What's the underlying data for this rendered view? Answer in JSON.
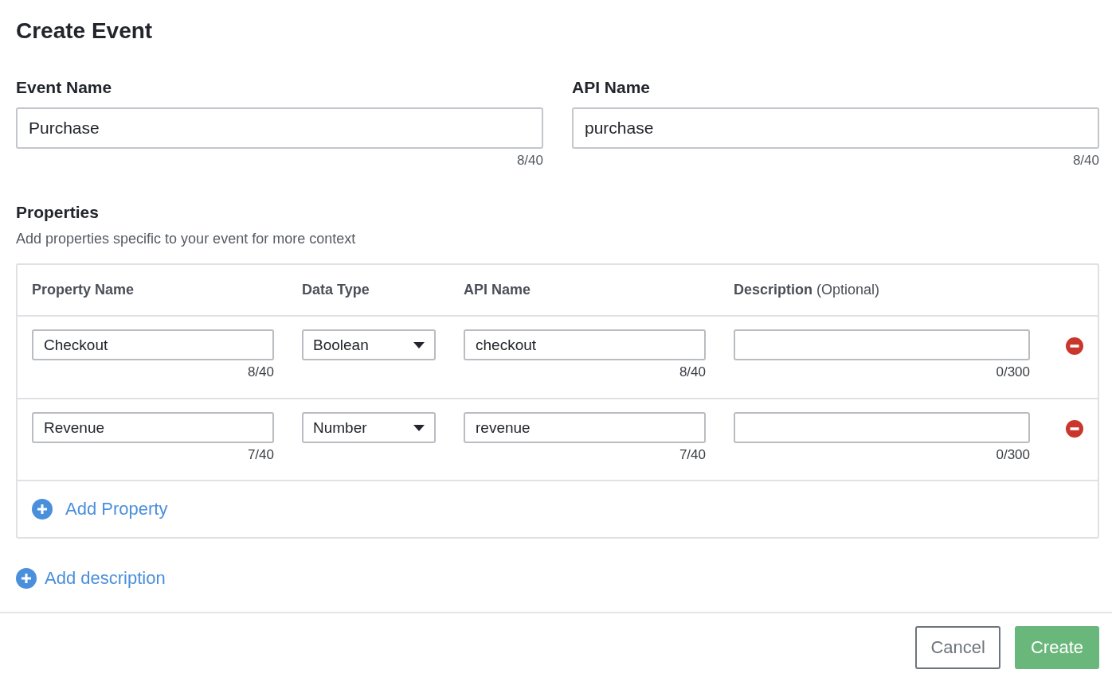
{
  "title": "Create Event",
  "fields": [
    {
      "label": "Event Name",
      "value": "Purchase",
      "counter": "8/40"
    },
    {
      "label": "API Name",
      "value": "purchase",
      "counter": "8/40"
    }
  ],
  "properties": {
    "heading": "Properties",
    "subtitle": "Add properties specific to your event for more context",
    "columns": [
      "Property Name",
      "Data Type",
      "API Name",
      "**Description** (Optional)"
    ],
    "rows": [
      {
        "name": "Checkout",
        "name_counter": "8/40",
        "data_type": "Boolean",
        "api_name": "checkout",
        "api_counter": "8/40",
        "description_counter": "0/300"
      },
      {
        "name": "Revenue",
        "name_counter": "7/40",
        "data_type": "Number",
        "api_name": "revenue",
        "api_counter": "7/40",
        "description_counter": "0/300"
      }
    ],
    "add_label": "Add Property"
  },
  "add_description": "Add description",
  "buttons": [
    {
      "label": "Cancel",
      "kind": "secondary"
    },
    {
      "label": "Create",
      "kind": "primary"
    }
  ]
}
